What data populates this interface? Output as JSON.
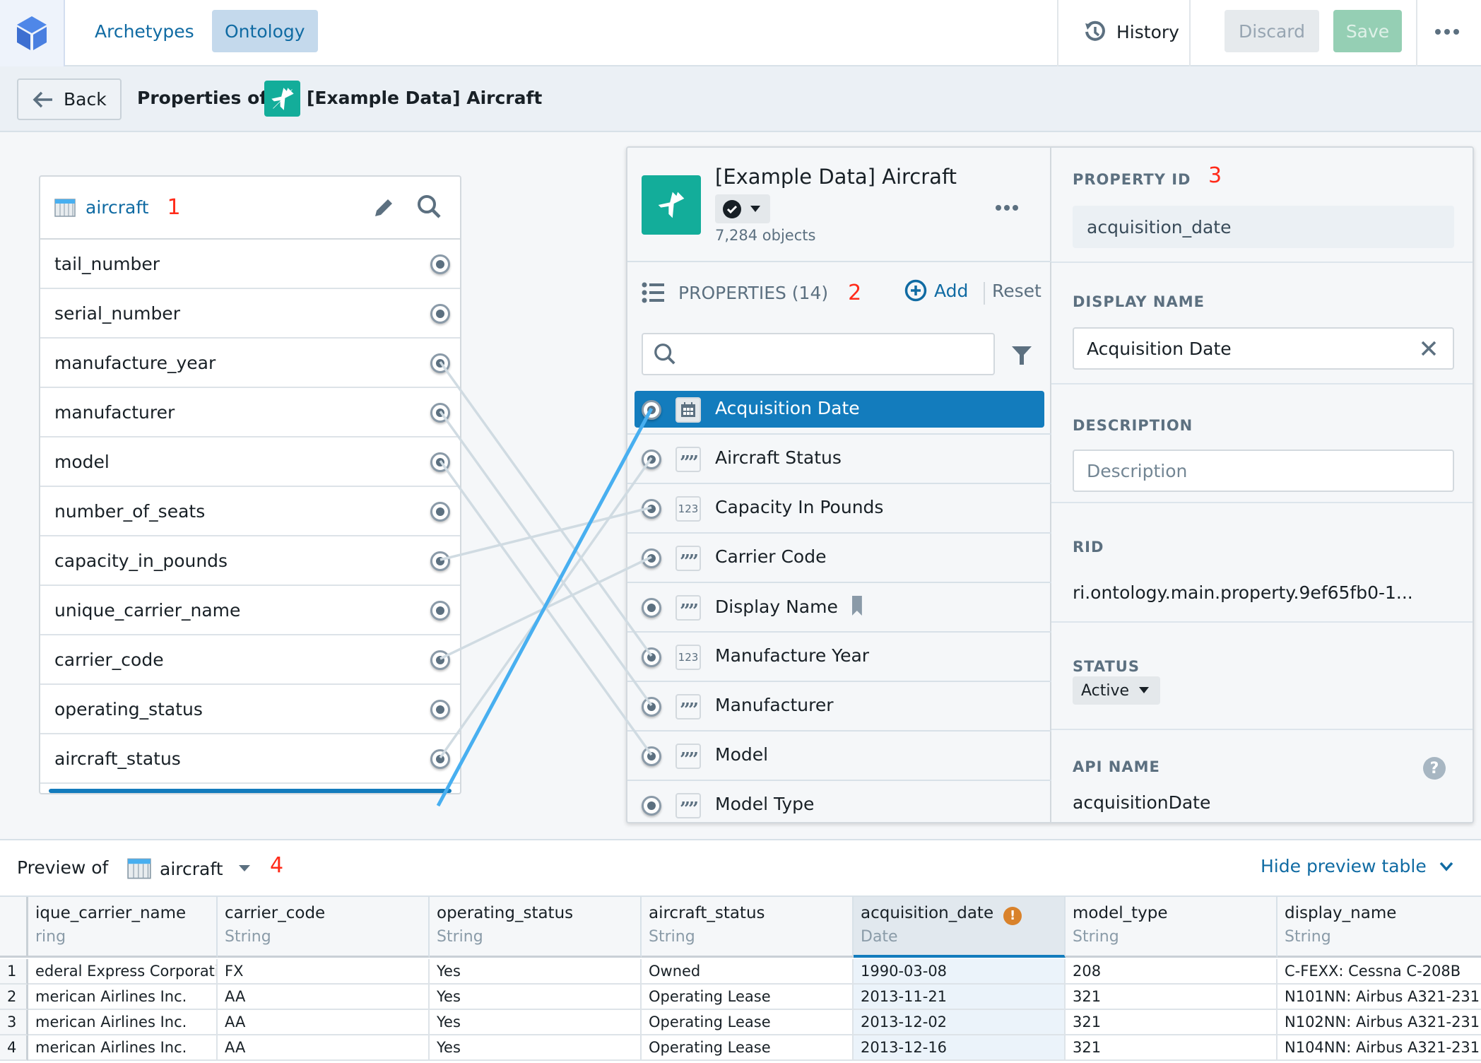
{
  "topbar": {
    "logo_icon": "cube-icon",
    "tabs": [
      {
        "label": "Archetypes",
        "active": false
      },
      {
        "label": "Ontology",
        "active": true
      }
    ],
    "history_label": "History",
    "discard_label": "Discard",
    "save_label": "Save",
    "more_icon": "more-horizontal-icon"
  },
  "subheader": {
    "back_label": "Back",
    "properties_of_label": "Properties of",
    "object_name": "[Example Data] Aircraft",
    "object_icon": "airplane-icon"
  },
  "left_panel": {
    "dataset_name": "aircraft",
    "marker": "1",
    "columns": [
      "tail_number",
      "serial_number",
      "manufacture_year",
      "manufacturer",
      "model",
      "number_of_seats",
      "capacity_in_pounds",
      "unique_carrier_name",
      "carrier_code",
      "operating_status",
      "aircraft_status"
    ]
  },
  "object_panel": {
    "title": "[Example Data] Aircraft",
    "object_count": "7,284 objects",
    "properties_label": "PROPERTIES (14)",
    "marker": "2",
    "add_label": "Add",
    "reset_label": "Reset",
    "search_placeholder": "",
    "properties": [
      {
        "name": "Acquisition Date",
        "type": "date",
        "selected": true
      },
      {
        "name": "Aircraft Status",
        "type": "string"
      },
      {
        "name": "Capacity In Pounds",
        "type": "number"
      },
      {
        "name": "Carrier Code",
        "type": "string"
      },
      {
        "name": "Display Name",
        "type": "string",
        "title_key": true
      },
      {
        "name": "Manufacture Year",
        "type": "number"
      },
      {
        "name": "Manufacturer",
        "type": "string"
      },
      {
        "name": "Model",
        "type": "string"
      },
      {
        "name": "Model Type",
        "type": "string"
      }
    ],
    "type_glyphs": {
      "date": "▦",
      "string": "99",
      "number": "123"
    },
    "mappings": [
      {
        "from": "manufacture_year",
        "to": "Manufacture Year"
      },
      {
        "from": "manufacturer",
        "to": "Manufacturer"
      },
      {
        "from": "model",
        "to": "Model"
      },
      {
        "from": "capacity_in_pounds",
        "to": "Capacity In Pounds"
      },
      {
        "from": "carrier_code",
        "to": "Carrier Code"
      },
      {
        "from": "aircraft_status",
        "to": "Aircraft Status"
      },
      {
        "from": "acquisition_date",
        "to": "Acquisition Date",
        "active": true
      }
    ]
  },
  "detail_panel": {
    "property_id_label": "PROPERTY ID",
    "marker": "3",
    "property_id": "acquisition_date",
    "display_name_label": "DISPLAY NAME",
    "display_name": "Acquisition Date",
    "description_label": "DESCRIPTION",
    "description_placeholder": "Description",
    "rid_label": "RID",
    "rid": "ri.ontology.main.property.9ef65fb0-1...",
    "status_label": "STATUS",
    "status_value": "Active",
    "api_name_label": "API NAME",
    "api_name": "acquisitionDate"
  },
  "preview": {
    "label": "Preview of",
    "dataset": "aircraft",
    "marker": "4",
    "hide_label": "Hide preview table",
    "columns": [
      {
        "name": "unique_carrier_name",
        "type": "String",
        "shown": "ique_carrier_name",
        "shown_type": "ring"
      },
      {
        "name": "carrier_code",
        "type": "String"
      },
      {
        "name": "operating_status",
        "type": "String"
      },
      {
        "name": "aircraft_status",
        "type": "String"
      },
      {
        "name": "acquisition_date",
        "type": "Date",
        "selected": true,
        "warning": true
      },
      {
        "name": "model_type",
        "type": "String"
      },
      {
        "name": "display_name",
        "type": "String"
      }
    ],
    "rows": [
      {
        "n": "1",
        "cells": [
          "ederal Express Corporation",
          "FX",
          "Yes",
          "Owned",
          "1990-03-08",
          "208",
          "C-FEXX: Cessna C-208B"
        ]
      },
      {
        "n": "2",
        "cells": [
          "merican Airlines Inc.",
          "AA",
          "Yes",
          "Operating Lease",
          "2013-11-21",
          "321",
          "N101NN: Airbus A321-231"
        ]
      },
      {
        "n": "3",
        "cells": [
          "merican Airlines Inc.",
          "AA",
          "Yes",
          "Operating Lease",
          "2013-12-02",
          "321",
          "N102NN: Airbus A321-231"
        ]
      },
      {
        "n": "4",
        "cells": [
          "merican Airlines Inc.",
          "AA",
          "Yes",
          "Operating Lease",
          "2013-12-16",
          "321",
          "N104NN: Airbus A321-231"
        ]
      }
    ]
  },
  "colors": {
    "accent": "#137cbd",
    "link": "#106ba3",
    "object_icon_bg": "#13ad9a",
    "connector": "#d0dbe2",
    "connector_active": "#48aff0",
    "marker_red": "#ff2b1a",
    "warning": "#d9822b"
  }
}
